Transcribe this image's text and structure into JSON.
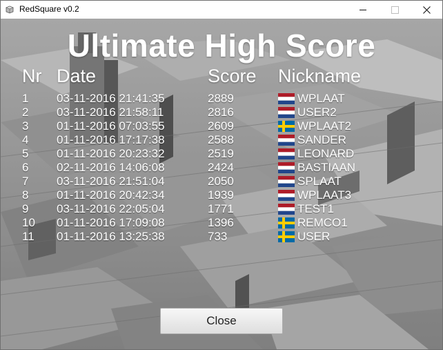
{
  "window": {
    "title": "RedSquare v0.2"
  },
  "heading": "Ultimate High Score",
  "columns": {
    "nr": "Nr",
    "date": "Date",
    "score": "Score",
    "nickname": "Nickname"
  },
  "rows": [
    {
      "nr": "1",
      "date": "03-11-2016 21:41:35",
      "score": "2889",
      "flag": "netherlands-flag-icon",
      "nickname": "WPLAAT"
    },
    {
      "nr": "2",
      "date": "03-11-2016 21:58:11",
      "score": "2816",
      "flag": "netherlands-flag-icon",
      "nickname": "USER2"
    },
    {
      "nr": "3",
      "date": "01-11-2016 07:03:55",
      "score": "2609",
      "flag": "sweden-flag-icon",
      "nickname": "WPLAAT2"
    },
    {
      "nr": "4",
      "date": "01-11-2016 17:17:38",
      "score": "2588",
      "flag": "netherlands-flag-icon",
      "nickname": "SANDER"
    },
    {
      "nr": "5",
      "date": "01-11-2016 20:23:32",
      "score": "2519",
      "flag": "netherlands-flag-icon",
      "nickname": "LEONARD"
    },
    {
      "nr": "6",
      "date": "02-11-2016 14:06:08",
      "score": "2424",
      "flag": "netherlands-flag-icon",
      "nickname": "BASTIAAN"
    },
    {
      "nr": "7",
      "date": "03-11-2016 21:51:04",
      "score": "2050",
      "flag": "netherlands-flag-icon",
      "nickname": "SPLAAT"
    },
    {
      "nr": "8",
      "date": "01-11-2016 20:42:34",
      "score": "1939",
      "flag": "netherlands-flag-icon",
      "nickname": "WPLAAT3"
    },
    {
      "nr": "9",
      "date": "03-11-2016 22:05:04",
      "score": "1771",
      "flag": "netherlands-flag-icon",
      "nickname": "TEST1"
    },
    {
      "nr": "10",
      "date": "01-11-2016 17:09:08",
      "score": "1396",
      "flag": "sweden-flag-icon",
      "nickname": "REMCO1"
    },
    {
      "nr": "11",
      "date": "01-11-2016 13:25:38",
      "score": "733",
      "flag": "sweden-flag-icon",
      "nickname": "USER"
    }
  ],
  "close_button": "Close",
  "colors": {
    "nl_red": "#ae1c28",
    "nl_white": "#ffffff",
    "nl_blue": "#21468b",
    "se_blue": "#006aa7",
    "se_yellow": "#fecc00",
    "text": "#ffffff"
  }
}
